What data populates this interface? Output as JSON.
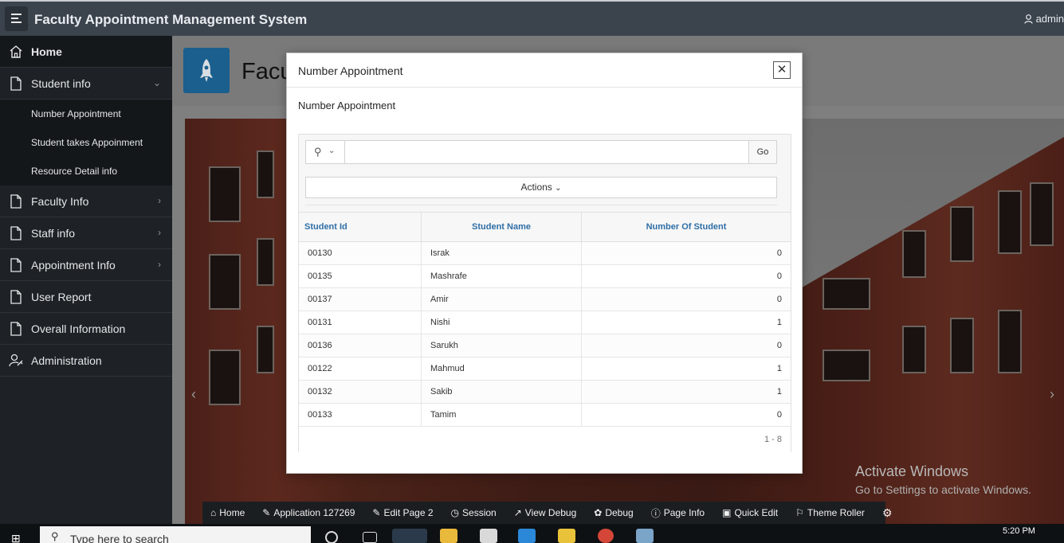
{
  "header": {
    "app_title": "Faculty Appointment Management System",
    "user": "admin"
  },
  "sidebar": {
    "items": [
      {
        "label": "Home",
        "icon": "home-icon"
      },
      {
        "label": "Student info",
        "icon": "page-icon",
        "expanded": true,
        "children": [
          "Number Appointment",
          "Student takes Appoinment",
          "Resource Detail info"
        ]
      },
      {
        "label": "Faculty Info",
        "icon": "page-icon"
      },
      {
        "label": "Staff info",
        "icon": "page-icon"
      },
      {
        "label": "Appointment Info",
        "icon": "page-icon"
      },
      {
        "label": "User Report",
        "icon": "page-icon"
      },
      {
        "label": "Overall Information",
        "icon": "page-icon"
      },
      {
        "label": "Administration",
        "icon": "user-key-icon"
      }
    ]
  },
  "main": {
    "hero_title": "Facu",
    "watermark_line1": "Activate Windows",
    "watermark_line2": "Go to Settings to activate Windows."
  },
  "modal": {
    "title": "Number Appointment",
    "region_title": "Number Appointment",
    "search": {
      "value": "",
      "go_label": "Go"
    },
    "actions_label": "Actions",
    "columns": [
      "Student Id",
      "Student Name",
      "Number Of Student"
    ],
    "rows": [
      {
        "id": "00130",
        "name": "Israk",
        "count": "0"
      },
      {
        "id": "00135",
        "name": "Mashrafe",
        "count": "0"
      },
      {
        "id": "00137",
        "name": "Amir",
        "count": "0"
      },
      {
        "id": "00131",
        "name": "Nishi",
        "count": "1"
      },
      {
        "id": "00136",
        "name": "Sarukh",
        "count": "0"
      },
      {
        "id": "00122",
        "name": "Mahmud",
        "count": "1"
      },
      {
        "id": "00132",
        "name": "Sakib",
        "count": "1"
      },
      {
        "id": "00133",
        "name": "Tamim",
        "count": "0"
      }
    ],
    "pagination": "1 - 8"
  },
  "devbar": {
    "items": [
      "Home",
      "Application 127269",
      "Edit Page 2",
      "Session",
      "View Debug",
      "Debug",
      "Page Info",
      "Quick Edit",
      "Theme Roller"
    ]
  },
  "taskbar": {
    "search_placeholder": "Type here to search",
    "time": "5:20 PM"
  },
  "colors": {
    "header_bg": "#3b434d",
    "sidebar_bg": "#1e2226",
    "accent": "#2f6ea6",
    "hero_icon_bg": "#1a5f8e"
  }
}
